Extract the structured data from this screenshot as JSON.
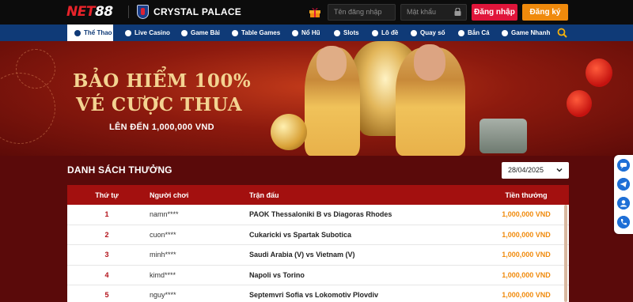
{
  "header": {
    "logo_part1": "NET",
    "logo_part2": "88",
    "partner_name": "CRYSTAL PALACE",
    "username_placeholder": "Tên đăng nhập",
    "password_placeholder": "Mật khẩu",
    "login_label": "Đăng nhập",
    "register_label": "Đăng ký"
  },
  "nav": {
    "items": [
      {
        "label": "Thể Thao",
        "icon": "soccer-ball-icon"
      },
      {
        "label": "Live Casino",
        "icon": "casino-chip-icon"
      },
      {
        "label": "Game Bài",
        "icon": "playing-cards-icon"
      },
      {
        "label": "Table Games",
        "icon": "table-games-icon"
      },
      {
        "label": "Nổ Hũ",
        "icon": "slot-jar-icon"
      },
      {
        "label": "Slots",
        "icon": "slots-icon"
      },
      {
        "label": "Lô đề",
        "icon": "lottery-ball-icon"
      },
      {
        "label": "Quay số",
        "icon": "number-wheel-icon"
      },
      {
        "label": "Bắn Cá",
        "icon": "fish-icon"
      },
      {
        "label": "Game Nhanh",
        "icon": "fast-game-icon"
      }
    ],
    "active_index": 0
  },
  "banner": {
    "title_line1": "BẢO HIỂM 100%",
    "title_line2": "VÉ CƯỢC THUA",
    "subtitle": "LÊN ĐẾN 1,000,000 VND"
  },
  "rewards": {
    "title": "DANH SÁCH THƯỞNG",
    "date_value": "28/04/2025",
    "columns": [
      "Thứ tự",
      "Người chơi",
      "Trận đấu",
      "Tiền thưởng"
    ],
    "rows": [
      {
        "rank": "1",
        "player": "namn****",
        "match": "PAOK Thessaloniki B vs Diagoras Rhodes",
        "prize": "1,000,000 VND"
      },
      {
        "rank": "2",
        "player": "cuon****",
        "match": "Cukaricki vs Spartak Subotica",
        "prize": "1,000,000 VND"
      },
      {
        "rank": "3",
        "player": "minh****",
        "match": "Saudi Arabia (V) vs Vietnam (V)",
        "prize": "1,000,000 VND"
      },
      {
        "rank": "4",
        "player": "kimd****",
        "match": "Napoli vs Torino",
        "prize": "1,000,000 VND"
      },
      {
        "rank": "5",
        "player": "nguy****",
        "match": "Septemvri Sofia vs Lokomotiv Plovdiv",
        "prize": "1,000,000 VND"
      }
    ]
  },
  "float_contacts": [
    "chat-icon",
    "telegram-icon",
    "support-agent-icon",
    "phone-icon"
  ],
  "colors": {
    "brand_red": "#e8232a",
    "nav_blue": "#0f3a77",
    "login_red": "#e0153a",
    "register_orange": "#f08a0c",
    "table_header": "#a3100f",
    "page_bg": "#5a0a0a",
    "banner_gold": "#f3d391"
  }
}
